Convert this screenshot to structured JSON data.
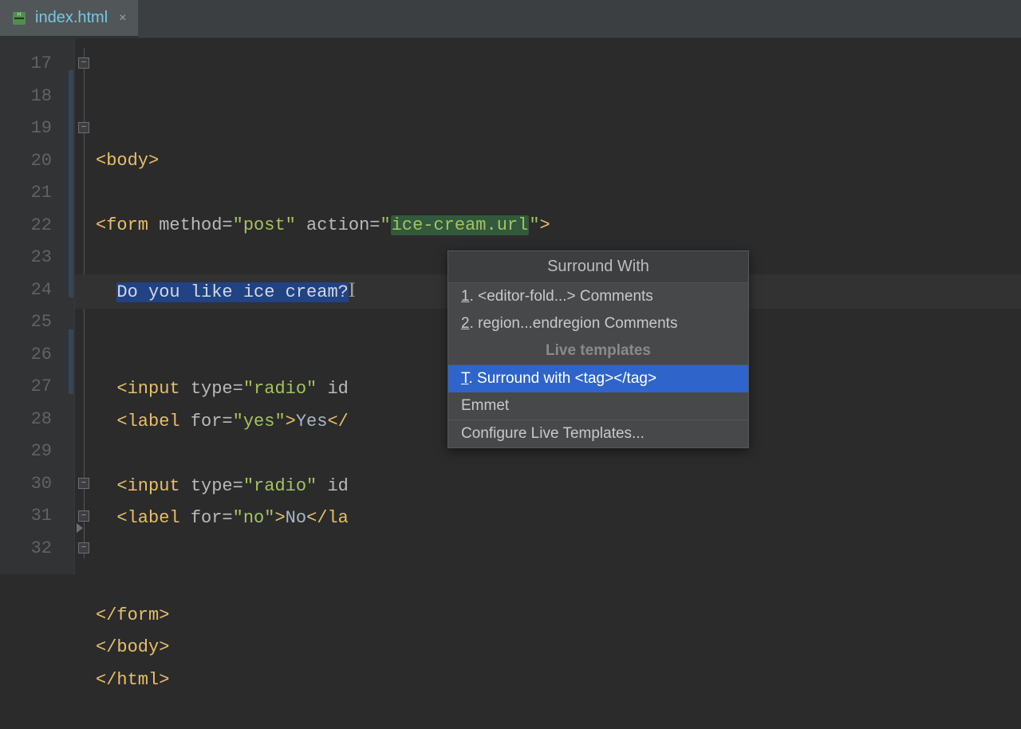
{
  "tab": {
    "filename": "index.html"
  },
  "lines": {
    "start": 17,
    "end": 32
  },
  "code": {
    "l17": {
      "tag_open": "<body>"
    },
    "l19_form_open": "<form",
    "l19_method_attr": " method=",
    "l19_method_val": "\"post\"",
    "l19_action_attr": " action=",
    "l19_action_q1": "\"",
    "l19_action_val": "ice-cream.url",
    "l19_action_q2": "\"",
    "l19_form_close": ">",
    "l21_text": "Do you like ice cream?",
    "l23_input": "<input",
    "l23_type_attr": " type=",
    "l23_type_val": "\"radio\"",
    "l23_id_attr": " id",
    "l24_label": "<label",
    "l24_for_attr": " for=",
    "l24_for_val": "\"yes\"",
    "l24_close": ">",
    "l24_text": "Yes",
    "l24_end": "</",
    "l26_input": "<input",
    "l26_type_attr": " type=",
    "l26_type_val": "\"radio\"",
    "l26_id_attr": " id",
    "l27_label": "<label",
    "l27_for_attr": " for=",
    "l27_for_val": "\"no\"",
    "l27_close": ">",
    "l27_text": "No",
    "l27_end": "</la",
    "l30": "</form>",
    "l31": "</body>",
    "l32": "</html>"
  },
  "popup": {
    "title": "Surround With",
    "item1_key": "1",
    "item1_label": ". <editor-fold...> Comments",
    "item2_key": "2",
    "item2_label": ". region...endregion Comments",
    "section": "Live templates",
    "item3_key": "T",
    "item3_label": ". Surround with <tag></tag>",
    "item4": "Emmet",
    "item5": "Configure Live Templates..."
  }
}
